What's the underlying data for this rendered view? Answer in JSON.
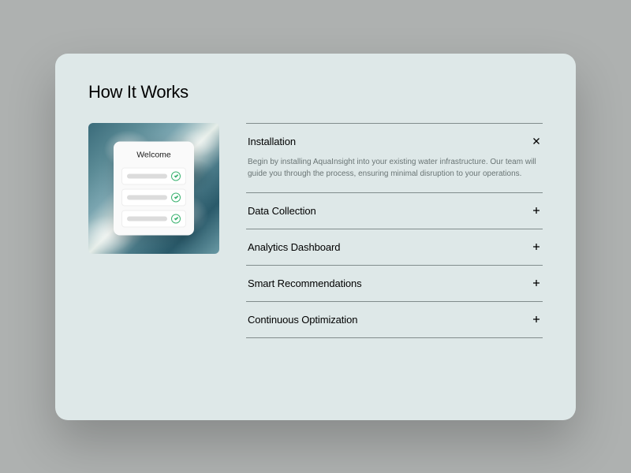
{
  "title": "How It Works",
  "illustration": {
    "card_title": "Welcome"
  },
  "accordion": [
    {
      "label": "Installation",
      "expanded": true,
      "body": "Begin by installing AquaInsight into your existing water infrastructure. Our team will guide you through the process, ensuring minimal disruption to your operations."
    },
    {
      "label": "Data Collection",
      "expanded": false
    },
    {
      "label": "Analytics Dashboard",
      "expanded": false
    },
    {
      "label": "Smart Recommendations",
      "expanded": false
    },
    {
      "label": "Continuous Optimization",
      "expanded": false
    }
  ]
}
